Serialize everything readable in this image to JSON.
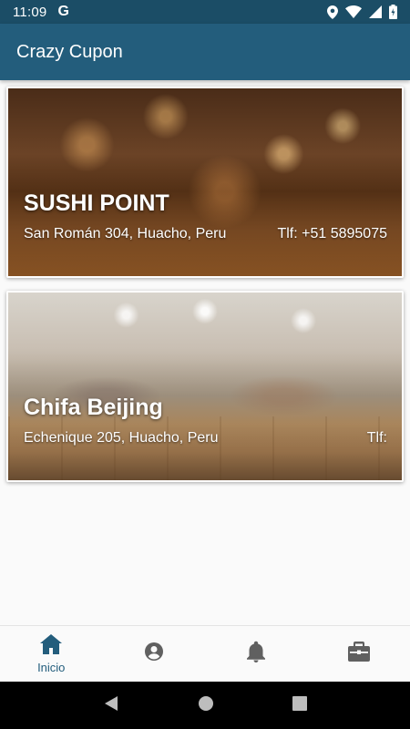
{
  "status_bar": {
    "time": "11:09",
    "carrier_glyph": "G",
    "icons": [
      "location-icon",
      "wifi-icon",
      "signal-icon",
      "battery-icon"
    ]
  },
  "app_bar": {
    "title": "Crazy Cupon",
    "color": "#235d7c"
  },
  "restaurants": [
    {
      "name": "SUSHI POINT",
      "address": "San Román 304, Huacho, Peru",
      "phone": "Tlf: +51 5895075"
    },
    {
      "name": "Chifa Beijing",
      "address": "Echenique 205, Huacho, Peru",
      "phone": "Tlf:"
    }
  ],
  "bottom_nav": {
    "items": [
      {
        "icon": "home-icon",
        "label": "Inicio",
        "active": true
      },
      {
        "icon": "account-icon",
        "label": "",
        "active": false
      },
      {
        "icon": "bell-icon",
        "label": "",
        "active": false
      },
      {
        "icon": "briefcase-icon",
        "label": "",
        "active": false
      }
    ],
    "active_color": "#235d7c"
  },
  "system_nav": {
    "icons": [
      "back-icon",
      "home-circle-icon",
      "recents-icon"
    ]
  }
}
